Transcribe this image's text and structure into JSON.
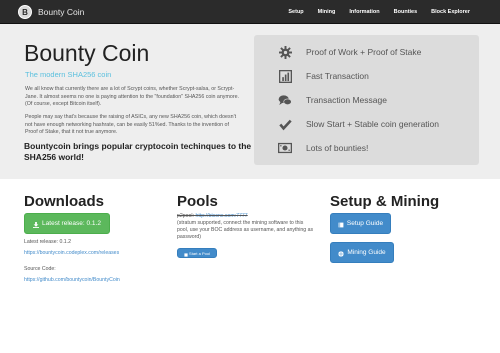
{
  "nav": {
    "brand": "Bounty Coin",
    "items": [
      "Setup",
      "Mining",
      "Information",
      "Bounties",
      "Block Explorer"
    ]
  },
  "hero": {
    "title": "Bounty Coin",
    "tagline": "The modern SHA256 coin",
    "p1": "We all know that currently there are a lot of Scrypt coins, whether Scrypt-salsa, or Scrypt-Jane. It almost seems no one is paying attention to the \"foundation\" SHA256 coin anymore. (Of course, except Bitcoin itself).",
    "p2": "People may say that's because the raising of ASICs, any new SHA256 coin, which doesn't not have enough networking hashrate, can be easily 51%ed. Thanks to the invention of Proof of Stake, that it not true anymore.",
    "subheading": "Bountycoin brings popular cryptocoin techinques to the SHA256 world!"
  },
  "features": [
    {
      "icon": "gear-icon",
      "label": "Proof of Work + Proof of Stake"
    },
    {
      "icon": "bar-chart-icon",
      "label": "Fast Transaction"
    },
    {
      "icon": "comments-icon",
      "label": "Transaction Message"
    },
    {
      "icon": "check-icon",
      "label": "Slow Start + Stable coin generation"
    },
    {
      "icon": "money-icon",
      "label": "Lots of bounties!"
    }
  ],
  "downloads": {
    "title": "Downloads",
    "button": "Latest release: 0.1.2",
    "latest_label": "Latest release: 0.1.2",
    "latest_link": "https://bountycoin.codeplex.com/releases",
    "source_label": "Source Code:",
    "source_link": "https://github.com/bountycoin/BountyCoin"
  },
  "pools": {
    "title": "Pools",
    "pool_prefix": "p2pool:",
    "pool_link": "http://btccns.com:7777",
    "pool_desc": "(stratum supported, connect the mining software to this pool, use your BOC address as username, and anything as password)",
    "button": "Start a Pool"
  },
  "setup": {
    "title": "Setup & Mining",
    "setup_button": "Setup Guide",
    "mining_button": "Mining Guide"
  },
  "colors": {
    "navbar": "#2b2b2b",
    "jumbotron": "#eeeeee",
    "panel": "#dcdcdc",
    "green": "#5cb85c",
    "blue": "#428bca",
    "tagline": "#5bc0de"
  }
}
